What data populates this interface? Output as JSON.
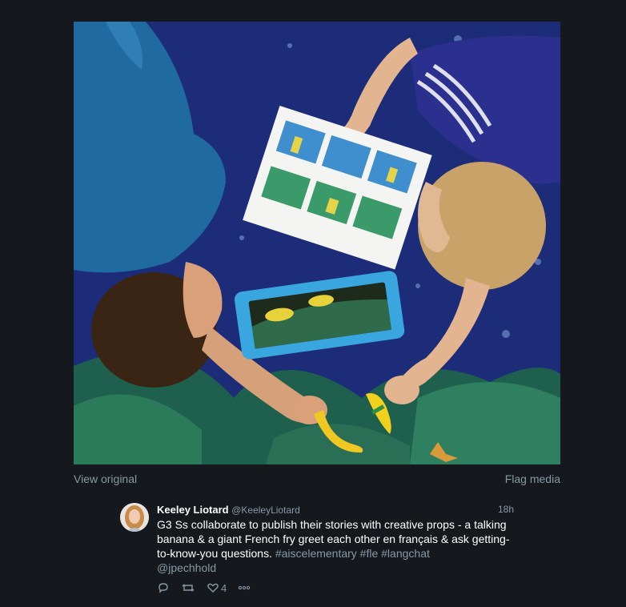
{
  "photo": {
    "alt_icon": "photo-children-storyboard"
  },
  "links": {
    "view_original": "View original",
    "flag_media": "Flag media"
  },
  "tweet": {
    "name": "Keeley Liotard",
    "handle": "@KeeleyLiotard",
    "time": "18h",
    "text": "G3 Ss collaborate to publish their stories with creative props - a talking banana & a giant French fry greet each other en français & ask getting-to-know-you questions.",
    "hashtags": "#aiscelementary #fle #langchat",
    "mention": "@jpechhold",
    "like_count": "4"
  },
  "colors": {
    "background": "#15181c",
    "muted": "#8899a6",
    "text": "#ffffff"
  },
  "icons": [
    "reply-icon",
    "retweet-icon",
    "like-icon",
    "more-icon"
  ]
}
